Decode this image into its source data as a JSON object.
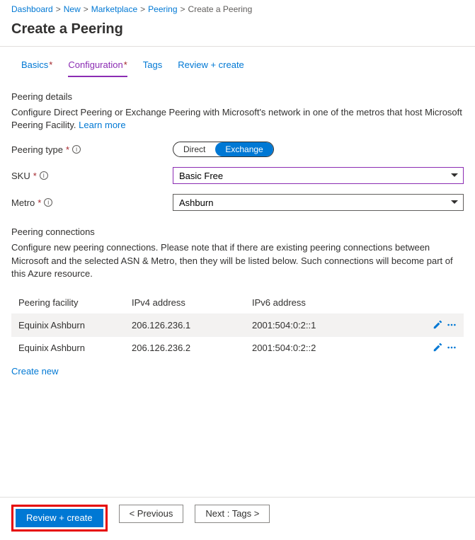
{
  "breadcrumb": [
    "Dashboard",
    "New",
    "Marketplace",
    "Peering",
    "Create a Peering"
  ],
  "title": "Create a Peering",
  "tabs": [
    {
      "label": "Basics",
      "required": true,
      "active": false
    },
    {
      "label": "Configuration",
      "required": true,
      "active": true
    },
    {
      "label": "Tags",
      "required": false,
      "active": false
    },
    {
      "label": "Review + create",
      "required": false,
      "active": false
    }
  ],
  "details": {
    "heading": "Peering details",
    "desc": "Configure Direct Peering or Exchange Peering with Microsoft's network in one of the metros that host Microsoft Peering Facility. ",
    "learn": "Learn more"
  },
  "fields": {
    "peering_type_label": "Peering type",
    "peering_type_options": [
      "Direct",
      "Exchange"
    ],
    "peering_type_selected": "Exchange",
    "sku_label": "SKU",
    "sku_value": "Basic Free",
    "metro_label": "Metro",
    "metro_value": "Ashburn"
  },
  "connections": {
    "heading": "Peering connections",
    "desc": "Configure new peering connections. Please note that if there are existing peering connections between Microsoft and the selected ASN & Metro, then they will be listed below. Such connections will become part of this Azure resource.",
    "columns": [
      "Peering facility",
      "IPv4 address",
      "IPv6 address"
    ],
    "rows": [
      {
        "facility": "Equinix Ashburn",
        "v4": "206.126.236.1",
        "v6": "2001:504:0:2::1"
      },
      {
        "facility": "Equinix Ashburn",
        "v4": "206.126.236.2",
        "v6": "2001:504:0:2::2"
      }
    ],
    "create_new": "Create new"
  },
  "footer": {
    "review": "Review + create",
    "prev": "< Previous",
    "next": "Next : Tags >"
  }
}
